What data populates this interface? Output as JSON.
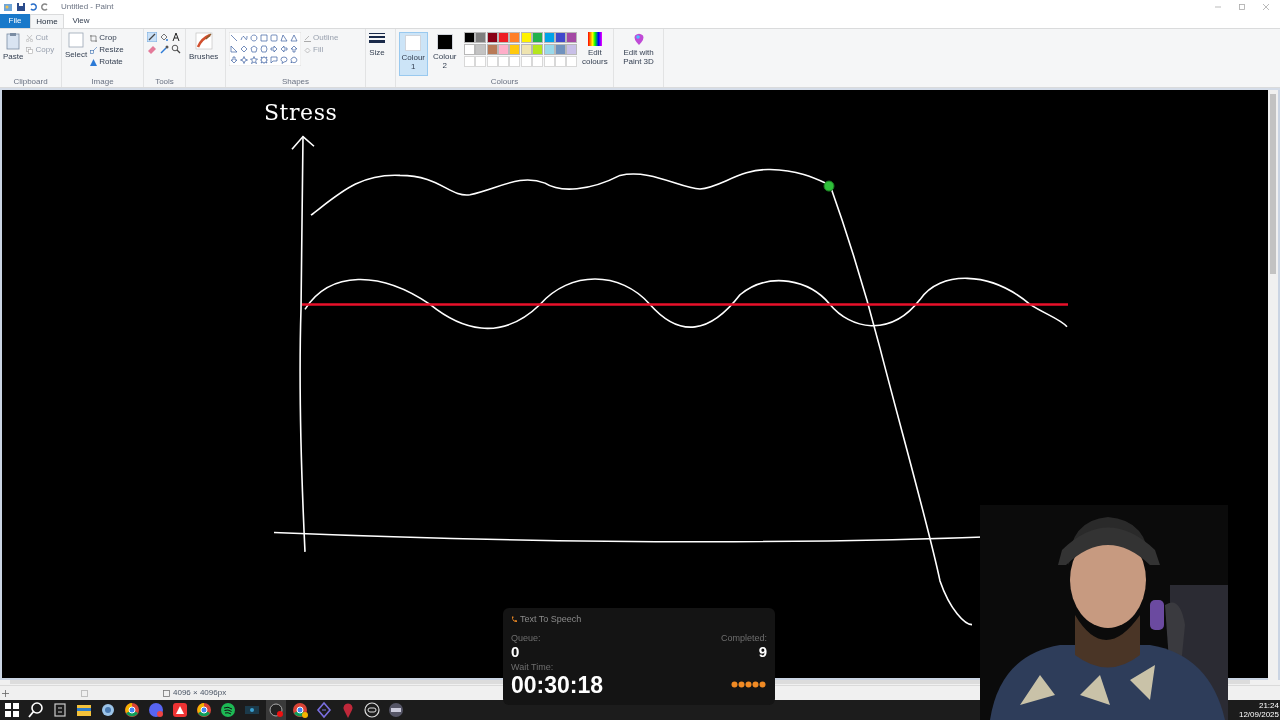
{
  "window": {
    "title": "Untitled - Paint"
  },
  "file_menu": "File",
  "tabs": [
    {
      "label": "Home",
      "selected": true
    },
    {
      "label": "View",
      "selected": false
    }
  ],
  "ribbon": {
    "clipboard": {
      "label": "Clipboard",
      "paste": "Paste",
      "buttons": [
        {
          "label": "Cut",
          "disabled": true
        },
        {
          "label": "Copy",
          "disabled": true
        }
      ]
    },
    "image": {
      "label": "Image",
      "select": "Select",
      "buttons": [
        {
          "label": "Crop"
        },
        {
          "label": "Resize"
        },
        {
          "label": "Rotate"
        }
      ]
    },
    "tools": {
      "label": "Tools"
    },
    "brushes": {
      "label": "Brushes"
    },
    "shapes": {
      "label": "Shapes",
      "outline": {
        "label": "Outline",
        "disabled": true
      },
      "fill": {
        "label": "Fill",
        "disabled": true
      }
    },
    "size": {
      "label": "Size"
    },
    "colours": {
      "label": "Colours",
      "slots": [
        {
          "label": "Colour",
          "index": "1",
          "color": "#ffffff",
          "selected": true
        },
        {
          "label": "Colour",
          "index": "2",
          "color": "#000000",
          "selected": false
        }
      ],
      "palette": [
        {
          "color": "#000000"
        },
        {
          "color": "#7f7f7f"
        },
        {
          "color": "#880015"
        },
        {
          "color": "#ed1c24"
        },
        {
          "color": "#ff7f27"
        },
        {
          "color": "#fff200"
        },
        {
          "color": "#22b14c"
        },
        {
          "color": "#00a2e8"
        },
        {
          "color": "#3f48cc"
        },
        {
          "color": "#a349a4"
        },
        {
          "color": "#ffffff"
        },
        {
          "color": "#c3c3c3"
        },
        {
          "color": "#b97a57"
        },
        {
          "color": "#ffaec9"
        },
        {
          "color": "#ffc90e"
        },
        {
          "color": "#efe4b0"
        },
        {
          "color": "#b5e61d"
        },
        {
          "color": "#99d9ea"
        },
        {
          "color": "#7092be"
        },
        {
          "color": "#c8bfe7"
        }
      ],
      "edit": "Edit colours"
    },
    "paint3d": "Edit with Paint 3D"
  },
  "canvas": {
    "label": "Stress"
  },
  "status_bar": {
    "dimensions": "4096 × 4096px"
  },
  "overlay": {
    "title": "Text To Speech",
    "queue_label": "Queue:",
    "queue": "0",
    "completed_label": "Completed:",
    "completed": "9",
    "wait_label": "Wait Time:",
    "wait": "00:30:18"
  },
  "clock": {
    "time": "21:24",
    "date": "12/09/2025"
  }
}
